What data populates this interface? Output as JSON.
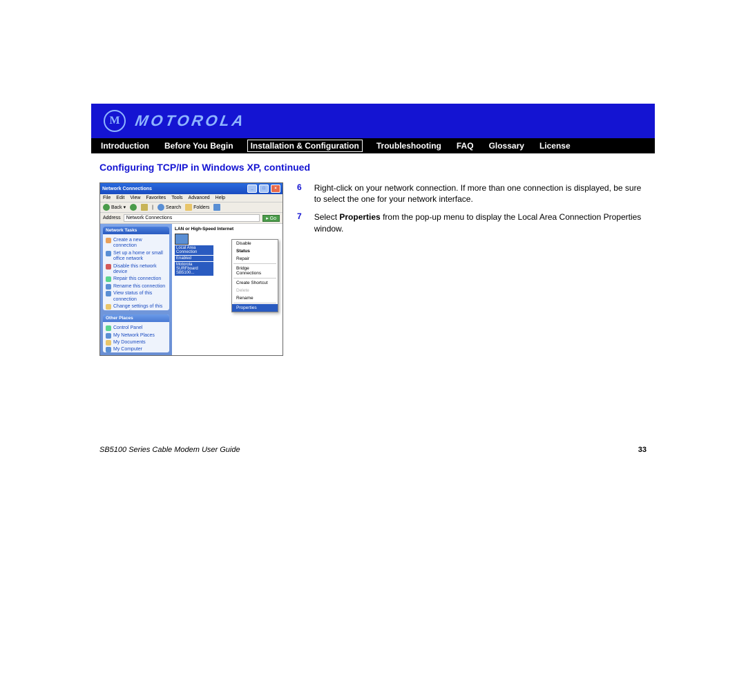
{
  "brand": "MOTOROLA",
  "nav": {
    "items": [
      "Introduction",
      "Before You Begin",
      "Installation & Configuration",
      "Troubleshooting",
      "FAQ",
      "Glossary",
      "License"
    ],
    "active_index": 2
  },
  "section_title": "Configuring TCP/IP in Windows XP, continued",
  "steps": [
    {
      "num": "6",
      "text": "Right-click on your network connection. If more than one connection is displayed, be sure to select the one for your network interface."
    },
    {
      "num": "7",
      "text_pre": "Select ",
      "text_bold": "Properties",
      "text_post": " from the pop-up menu to display the Local Area Connection Properties window."
    }
  ],
  "screenshot": {
    "title": "Network Connections",
    "menus": [
      "File",
      "Edit",
      "View",
      "Favorites",
      "Tools",
      "Advanced",
      "Help"
    ],
    "toolbar": {
      "back": "Back",
      "search": "Search",
      "folders": "Folders"
    },
    "address_label": "Address",
    "address_value": "Network Connections",
    "go": "Go",
    "panel1": {
      "title": "Network Tasks",
      "items": [
        "Create a new connection",
        "Set up a home or small office network",
        "Disable this network device",
        "Repair this connection",
        "Rename this connection",
        "View status of this connection",
        "Change settings of this connection"
      ]
    },
    "panel2": {
      "title": "Other Places",
      "items": [
        "Control Panel",
        "My Network Places",
        "My Documents",
        "My Computer"
      ]
    },
    "group": "LAN or High-Speed Internet",
    "conn_label1": "Local Area Connection",
    "conn_label2": "Enabled",
    "conn_label3": "Motorola SURFboard SB5100...",
    "context_menu": [
      "Disable",
      "Status",
      "Repair",
      "Bridge Connections",
      "Create Shortcut",
      "Delete",
      "Rename",
      "Properties"
    ]
  },
  "footer": {
    "guide": "SB5100 Series Cable Modem User Guide",
    "page": "33"
  }
}
